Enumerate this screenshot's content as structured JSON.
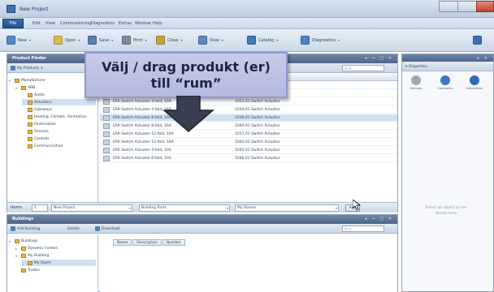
{
  "window": {
    "title": "New Project"
  },
  "menu": {
    "file": "File",
    "items": [
      "Edit",
      "View",
      "Commissioning",
      "Diagnostics",
      "Extras",
      "Window",
      "Help"
    ]
  },
  "toolbar": {
    "buttons": [
      {
        "label": "New",
        "icon": "new-icon",
        "color": "#4f88c9"
      },
      {
        "label": "Open",
        "icon": "open-folder-icon",
        "color": "#e0b94e"
      },
      {
        "label": "Save",
        "icon": "save-icon",
        "color": "#5a7fb0"
      },
      {
        "label": "Print",
        "icon": "print-icon",
        "color": "#7c8da0"
      },
      {
        "label": "Close",
        "icon": "close-doc-icon",
        "color": "#c9a03e"
      },
      {
        "label": "View",
        "icon": "view-icon",
        "color": "#5b8ac2"
      },
      {
        "label": "Catalog",
        "icon": "catalog-icon",
        "color": "#3f78bd"
      },
      {
        "label": "Diagnostics",
        "icon": "diagnostics-icon",
        "color": "#4b86c6"
      }
    ],
    "right_button": {
      "label": "Help",
      "icon": "help-icon",
      "color": "#3d6fb0"
    }
  },
  "products_panel": {
    "title": "Product Finder",
    "controls": "▸ ‒ □ ✕",
    "subbar_button": "My Products",
    "search_placeholder": "Find",
    "tree": [
      {
        "label": "Manufacturer",
        "level": 0,
        "expander": "▾"
      },
      {
        "label": "ABB",
        "level": 1,
        "expander": "▾"
      },
      {
        "label": "Audio",
        "level": 2,
        "expander": ""
      },
      {
        "label": "Actuators",
        "level": 2,
        "expander": "",
        "selected": true
      },
      {
        "label": "Gateways",
        "level": 2,
        "expander": ""
      },
      {
        "label": "Heating, Climate, Ventilation",
        "level": 2,
        "expander": ""
      },
      {
        "label": "Illumination",
        "level": 2,
        "expander": ""
      },
      {
        "label": "Sensors",
        "level": 2,
        "expander": ""
      },
      {
        "label": "Controls",
        "level": 2,
        "expander": ""
      },
      {
        "label": "Communication",
        "level": 2,
        "expander": ""
      }
    ],
    "columns": [
      "Name",
      "Description"
    ],
    "rows": [
      {
        "name": "ERA Switch Actuator 2-fold, 10A",
        "desc": "1020.01 Actuator, 2-fold"
      },
      {
        "name": "ERA Switch Actuator 2-fold, 16A",
        "desc": "1018.01 Switch Actuator"
      },
      {
        "name": "ERA Switch Actuator 4-fold, 16A",
        "desc": "1022.01 Switch Actuator"
      },
      {
        "name": "ERA Switch Actuator 4-fold, 16A",
        "desc": "1034.01 Switch Actuator"
      },
      {
        "name": "ERA Switch Actuator 8-fold, 10A",
        "desc": "1036.01 Switch Actuator",
        "selected": true
      },
      {
        "name": "ERA Switch Actuator 8-fold, 16A",
        "desc": "1040.01 Switch Actuator"
      },
      {
        "name": "ERA Switch Actuator 12-fold, 10A",
        "desc": "1037.01 Switch Actuator"
      },
      {
        "name": "ERA Switch Actuator 12-fold, 16A",
        "desc": "1042.01 Switch Actuator"
      },
      {
        "name": "ERA Switch Actuator 4-fold, 10A",
        "desc": "1045.01 Switch Actuator"
      },
      {
        "name": "ERA Switch Actuator 6-fold, 10A",
        "desc": "1046.01 Switch Actuator"
      }
    ],
    "status": {
      "count_label": "Items",
      "count_value": "1",
      "project_combo": "New Project",
      "building_parts_combo": "Building Parts",
      "rooms_combo": "My Rooms",
      "add_button": "Add"
    }
  },
  "buildings_panel": {
    "title": "Buildings",
    "controls": "▸ ‒ □ ✕",
    "subbar_buttons": [
      "Add Building",
      "Delete",
      "Download"
    ],
    "search_placeholder": "Find",
    "tree": [
      {
        "label": "Buildings",
        "level": 0,
        "expander": "▾"
      },
      {
        "label": "Dynamic Folders",
        "level": 1,
        "expander": "▸"
      },
      {
        "label": "My Building",
        "level": 1,
        "expander": "▾"
      },
      {
        "label": "My Room",
        "level": 2,
        "expander": "",
        "selected": true
      },
      {
        "label": "Trades",
        "level": 1,
        "expander": ""
      }
    ],
    "tabs": [
      "Name",
      "Description",
      "Number"
    ]
  },
  "properties_panel": {
    "title": "Properties",
    "tabs": [
      {
        "label": "Settings",
        "icon": "settings-icon",
        "color": "#9aa8b7"
      },
      {
        "label": "Comments",
        "icon": "comments-icon",
        "color": "#3c78bf"
      },
      {
        "label": "Information",
        "icon": "info-icon",
        "color": "#2f6db8"
      }
    ],
    "empty_text": "Select an object to see details here"
  },
  "callout": {
    "line1": "Välj / drag produkt (er)",
    "line2": "till “rum”",
    "color": "#b9bfe2"
  }
}
